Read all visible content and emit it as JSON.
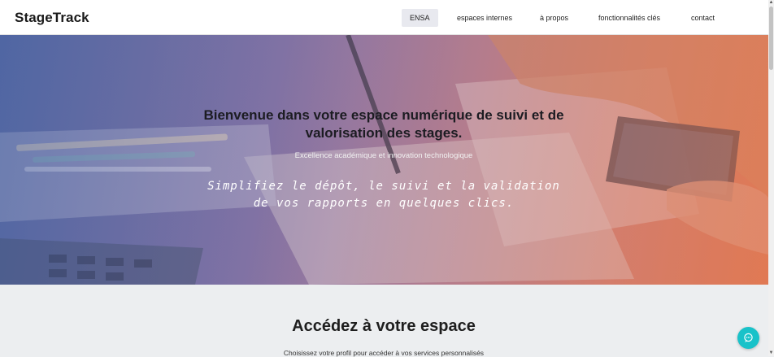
{
  "brand": {
    "name": "StageTrack"
  },
  "nav": {
    "items": [
      {
        "label": "ENSA",
        "active": true
      },
      {
        "label": "espaces internes",
        "active": false
      },
      {
        "label": "à propos",
        "active": false
      },
      {
        "label": "fonctionnalités clés",
        "active": false
      },
      {
        "label": "contact",
        "active": false
      }
    ]
  },
  "hero": {
    "title": "Bienvenue dans votre espace numérique de suivi et de valorisation des stages.",
    "subtitle": "Excellence académique et innovation technologique",
    "tagline": "Simplifiez le dépôt, le suivi et la validation de vos rapports en quelques clics."
  },
  "access": {
    "title": "Accédez à votre espace",
    "subtitle": "Choisissez votre profil pour accéder à vos services personnalisés"
  },
  "chat": {
    "icon": "chat-bubble-icon",
    "color": "#19c2c9"
  },
  "colors": {
    "hero_left": "#5b6fa6",
    "hero_right": "#df7a52",
    "nav_active_bg": "#e8e9ef"
  }
}
